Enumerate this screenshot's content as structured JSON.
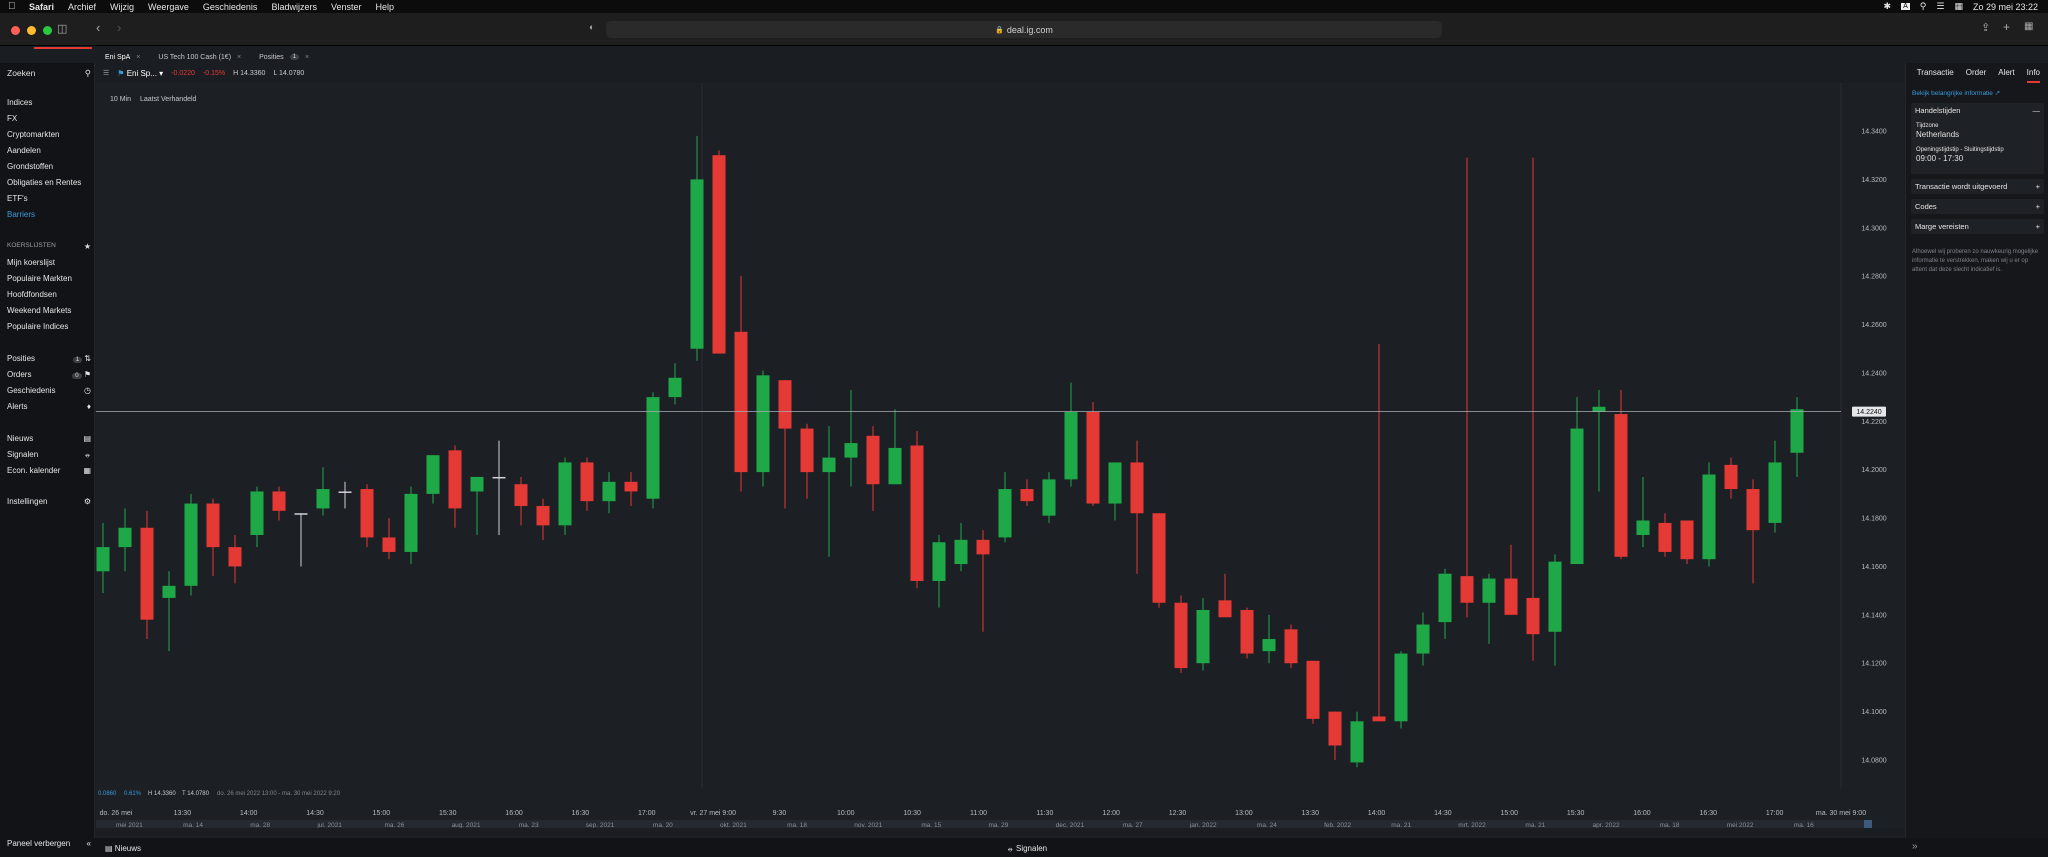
{
  "menubar": {
    "app": "Safari",
    "items": [
      "Archief",
      "Wijzig",
      "Weergave",
      "Geschiedenis",
      "Bladwijzers",
      "Venster",
      "Help"
    ],
    "clock": "Zo 29 mei 23:22"
  },
  "browser": {
    "url": "deal.ig.com"
  },
  "tabs": [
    {
      "label": "Eni SpA",
      "badge": ""
    },
    {
      "label": "US Tech 100 Cash (1€)",
      "badge": ""
    },
    {
      "label": "Posities",
      "badge": "1"
    }
  ],
  "sidebar": {
    "search_label": "Zoeken",
    "markets": [
      "Indices",
      "FX",
      "Cryptomarkten",
      "Aandelen",
      "Grondstoffen",
      "Obligaties en Rentes",
      "ETF's",
      "Barriers"
    ],
    "watchlists_title": "KOERSLIJSTEN",
    "watchlists": [
      "Mijn koerslijst",
      "Populaire Markten",
      "Hoofdfondsen",
      "Weekend Markets",
      "Populaire Indices"
    ],
    "account": [
      {
        "label": "Posities",
        "badge": "1"
      },
      {
        "label": "Orders",
        "badge": "0"
      },
      {
        "label": "Geschiedenis",
        "badge": ""
      },
      {
        "label": "Alerts",
        "badge": ""
      }
    ],
    "news": [
      "Nieuws",
      "Signalen",
      "Econ. kalender"
    ],
    "settings": "Instellingen"
  },
  "chart_header": {
    "instrument": "Eni Sp...",
    "change": "-0.0220",
    "change_pct": "-0.15%",
    "high": "H 14.3360",
    "low": "L 14.0780"
  },
  "chart_legend": {
    "interval": "10 Min",
    "price_type": "Laatst Verhandeld"
  },
  "chart_info": {
    "change": "0.0860",
    "change_pct": "0.61%",
    "high": "H 14.3360",
    "low": "T 14.0780",
    "range": "do. 26 mei 2022 13:00 - ma. 30 mei 2022 9:20"
  },
  "right_panel": {
    "tabs": [
      "Transactie",
      "Order",
      "Alert",
      "Info"
    ],
    "link": "Bekijk belangrijke informatie",
    "hours_title": "Handelstijden",
    "tz_label": "Tijdzone",
    "tz_value": "Netherlands",
    "open_label": "Openingstijdstip - Sluitingstijdstip",
    "open_value": "09:00 - 17:30",
    "sections": [
      "Transactie wordt uitgevoerd",
      "Codes",
      "Marge vereisten"
    ],
    "note": "Alhoewel wij proberen zo nauwkeurig mogelijke informatie te verstrekken, maken wij u er op attent dat deze slecht indicatief is."
  },
  "bottom": {
    "hide_panel": "Paneel verbergen",
    "news": "Nieuws",
    "signals": "Signalen"
  },
  "colors": {
    "up": "#1fa848",
    "down": "#e53935",
    "accent": "#3a9bdc"
  },
  "chart_data": {
    "type": "candlestick",
    "price_axis": [
      14.34,
      14.32,
      14.3,
      14.28,
      14.26,
      14.24,
      14.22,
      14.2,
      14.18,
      14.16,
      14.14,
      14.12,
      14.1,
      14.08
    ],
    "current_price": "14.2240",
    "time_labels": [
      "do. 26 mei",
      "13:30",
      "14:00",
      "14:30",
      "15:00",
      "15:30",
      "16:00",
      "16:30",
      "17:00",
      "vr. 27 mei 9:00",
      "9:30",
      "10:00",
      "10:30",
      "11:00",
      "11:30",
      "12:00",
      "12:30",
      "13:00",
      "13:30",
      "14:00",
      "14:30",
      "15:00",
      "15:30",
      "16:00",
      "16:30",
      "17:00",
      "ma. 30 mei 9:00"
    ],
    "navigator_labels": [
      "mei 2021",
      "ma. 14",
      "ma. 28",
      "jul. 2021",
      "ma. 26",
      "aug. 2021",
      "ma. 23",
      "sep. 2021",
      "ma. 20",
      "okt. 2021",
      "ma. 18",
      "nov. 2021",
      "ma. 15",
      "ma. 29",
      "dec. 2021",
      "ma. 27",
      "jan. 2022",
      "ma. 24",
      "feb. 2022",
      "ma. 21",
      "mrt. 2022",
      "ma. 21",
      "apr. 2022",
      "ma. 18",
      "mei 2022",
      "ma. 16"
    ],
    "candles": [
      [
        14.158,
        14.178,
        14.149,
        14.168
      ],
      [
        14.168,
        14.184,
        14.158,
        14.176
      ],
      [
        14.176,
        14.183,
        14.13,
        14.138
      ],
      [
        14.147,
        14.158,
        14.125,
        14.152
      ],
      [
        14.152,
        14.19,
        14.148,
        14.186
      ],
      [
        14.186,
        14.188,
        14.156,
        14.168
      ],
      [
        14.168,
        14.173,
        14.153,
        14.16
      ],
      [
        14.173,
        14.193,
        14.168,
        14.191
      ],
      [
        14.191,
        14.193,
        14.179,
        14.183
      ],
      [
        14.182,
        14.182,
        14.16,
        14.182
      ],
      [
        14.184,
        14.201,
        14.181,
        14.192
      ],
      [
        14.191,
        14.195,
        14.184,
        14.191
      ],
      [
        14.192,
        14.194,
        14.168,
        14.172
      ],
      [
        14.172,
        14.18,
        14.163,
        14.166
      ],
      [
        14.166,
        14.193,
        14.161,
        14.19
      ],
      [
        14.19,
        14.204,
        14.186,
        14.206
      ],
      [
        14.208,
        14.21,
        14.176,
        14.184
      ],
      [
        14.191,
        14.194,
        14.173,
        14.197
      ],
      [
        14.197,
        14.212,
        14.173,
        14.197
      ],
      [
        14.194,
        14.197,
        14.177,
        14.185
      ],
      [
        14.185,
        14.188,
        14.171,
        14.177
      ],
      [
        14.177,
        14.205,
        14.173,
        14.203
      ],
      [
        14.203,
        14.205,
        14.183,
        14.187
      ],
      [
        14.187,
        14.199,
        14.182,
        14.195
      ],
      [
        14.195,
        14.199,
        14.185,
        14.191
      ],
      [
        14.188,
        14.232,
        14.184,
        14.23
      ],
      [
        14.23,
        14.244,
        14.227,
        14.238
      ],
      [
        14.25,
        14.338,
        14.245,
        14.32
      ],
      [
        14.33,
        14.332,
        14.248,
        14.248
      ],
      [
        14.257,
        14.28,
        14.191,
        14.199
      ],
      [
        14.199,
        14.241,
        14.193,
        14.239
      ],
      [
        14.237,
        14.232,
        14.184,
        14.217
      ],
      [
        14.217,
        14.219,
        14.188,
        14.199
      ],
      [
        14.199,
        14.218,
        14.164,
        14.205
      ],
      [
        14.205,
        14.233,
        14.193,
        14.211
      ],
      [
        14.214,
        14.218,
        14.183,
        14.194
      ],
      [
        14.194,
        14.225,
        14.197,
        14.209
      ],
      [
        14.21,
        14.216,
        14.151,
        14.154
      ],
      [
        14.154,
        14.173,
        14.143,
        14.17
      ],
      [
        14.161,
        14.178,
        14.158,
        14.171
      ],
      [
        14.171,
        14.175,
        14.133,
        14.165
      ],
      [
        14.172,
        14.199,
        14.17,
        14.192
      ],
      [
        14.192,
        14.196,
        14.185,
        14.187
      ],
      [
        14.181,
        14.199,
        14.178,
        14.196
      ],
      [
        14.196,
        14.236,
        14.193,
        14.224
      ],
      [
        14.224,
        14.228,
        14.185,
        14.186
      ],
      [
        14.186,
        14.203,
        14.179,
        14.203
      ],
      [
        14.203,
        14.212,
        14.157,
        14.182
      ],
      [
        14.182,
        14.182,
        14.143,
        14.145
      ],
      [
        14.145,
        14.148,
        14.116,
        14.118
      ],
      [
        14.12,
        14.147,
        14.117,
        14.142
      ],
      [
        14.146,
        14.157,
        14.14,
        14.139
      ],
      [
        14.142,
        14.143,
        14.122,
        14.124
      ],
      [
        14.125,
        14.14,
        14.12,
        14.13
      ],
      [
        14.134,
        14.136,
        14.118,
        14.12
      ],
      [
        14.121,
        14.118,
        14.095,
        14.097
      ],
      [
        14.1,
        14.094,
        14.08,
        14.086
      ],
      [
        14.079,
        14.1,
        14.077,
        14.096
      ],
      [
        14.098,
        14.252,
        14.097,
        14.096
      ],
      [
        14.096,
        14.125,
        14.093,
        14.124
      ],
      [
        14.124,
        14.141,
        14.119,
        14.136
      ],
      [
        14.137,
        14.159,
        14.13,
        14.157
      ],
      [
        14.156,
        14.329,
        14.139,
        14.145
      ],
      [
        14.145,
        14.157,
        14.128,
        14.155
      ],
      [
        14.155,
        14.169,
        14.14,
        14.14
      ],
      [
        14.147,
        14.329,
        14.121,
        14.132
      ],
      [
        14.133,
        14.165,
        14.119,
        14.162
      ],
      [
        14.161,
        14.23,
        14.161,
        14.217
      ],
      [
        14.224,
        14.233,
        14.191,
        14.226
      ],
      [
        14.223,
        14.233,
        14.163,
        14.164
      ],
      [
        14.173,
        14.197,
        14.168,
        14.179
      ],
      [
        14.178,
        14.182,
        14.164,
        14.166
      ],
      [
        14.179,
        14.176,
        14.161,
        14.163
      ],
      [
        14.163,
        14.203,
        14.16,
        14.198
      ],
      [
        14.202,
        14.205,
        14.188,
        14.192
      ],
      [
        14.192,
        14.196,
        14.153,
        14.175
      ],
      [
        14.178,
        14.212,
        14.174,
        14.203
      ],
      [
        14.207,
        14.23,
        14.197,
        14.225
      ]
    ]
  }
}
